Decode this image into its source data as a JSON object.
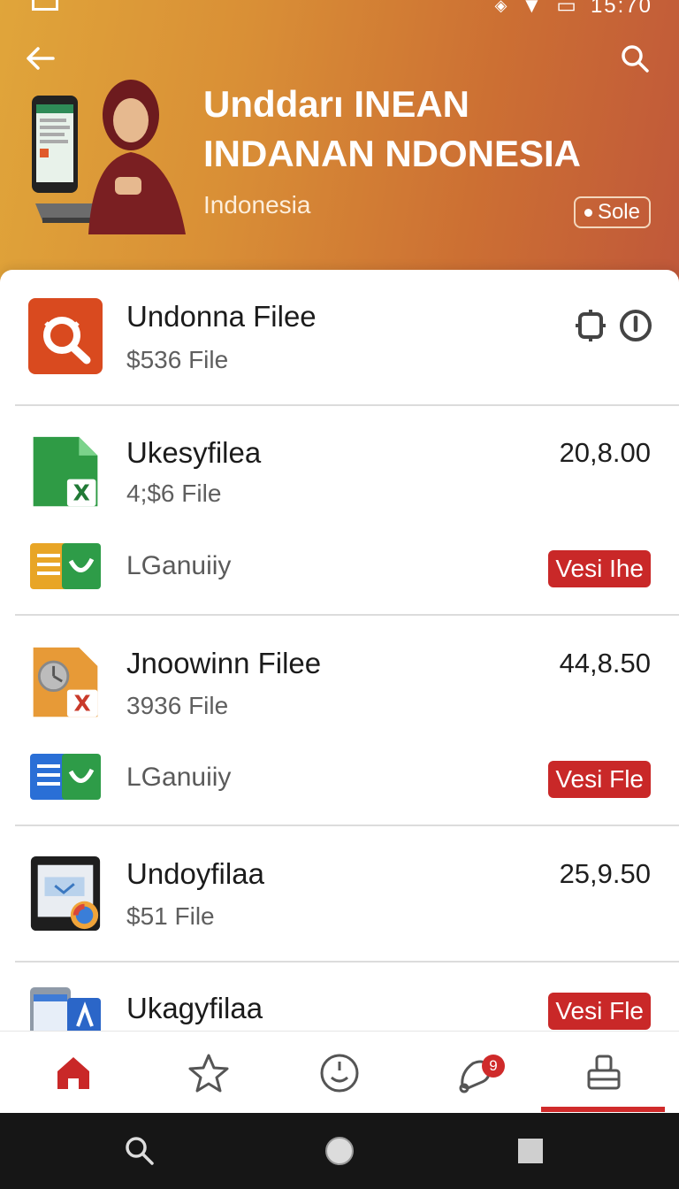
{
  "status": {
    "time": "15:70",
    "icons": [
      "signal-icon",
      "wifi-icon",
      "battery-icon"
    ]
  },
  "header": {
    "title_line1": "Unddarı INEAN",
    "title_line2": "INDANAN NDONESIA",
    "subtitle": "Indonesia",
    "badge": "Sole",
    "colors": {
      "gradient_start": "#e0a53a",
      "gradient_end": "#c0583a"
    }
  },
  "items": [
    {
      "name": "Undonna Filee",
      "meta": "$536 File",
      "icon": "search-app-icon"
    },
    {
      "name": "Ukesyfilea",
      "meta": "4;$6 File",
      "amount": "20,8.00",
      "icon": "spreadsheet-file-icon",
      "sub_label": "LGanuiiy",
      "sub_icon": "docs-folder-icon",
      "tag": "Vesi Ihe"
    },
    {
      "name": "Jnoowinn Filee",
      "meta": "3936 File",
      "amount": "44,8.50",
      "icon": "clock-file-icon",
      "sub_label": "LGanuiiy",
      "sub_icon": "blue-docs-icon",
      "tag": "Vesi Fle"
    },
    {
      "name": "Undoyfilaa",
      "meta": "$51 File",
      "amount": "25,9.50",
      "icon": "tablet-app-icon"
    },
    {
      "name": "Ukagyfilaa",
      "icon": "calendar-app-icon",
      "tag": "Vesi Fle"
    }
  ],
  "bottom_nav": {
    "notification_count": "9",
    "active_tab": "profile"
  },
  "accent_color": "#c92828"
}
